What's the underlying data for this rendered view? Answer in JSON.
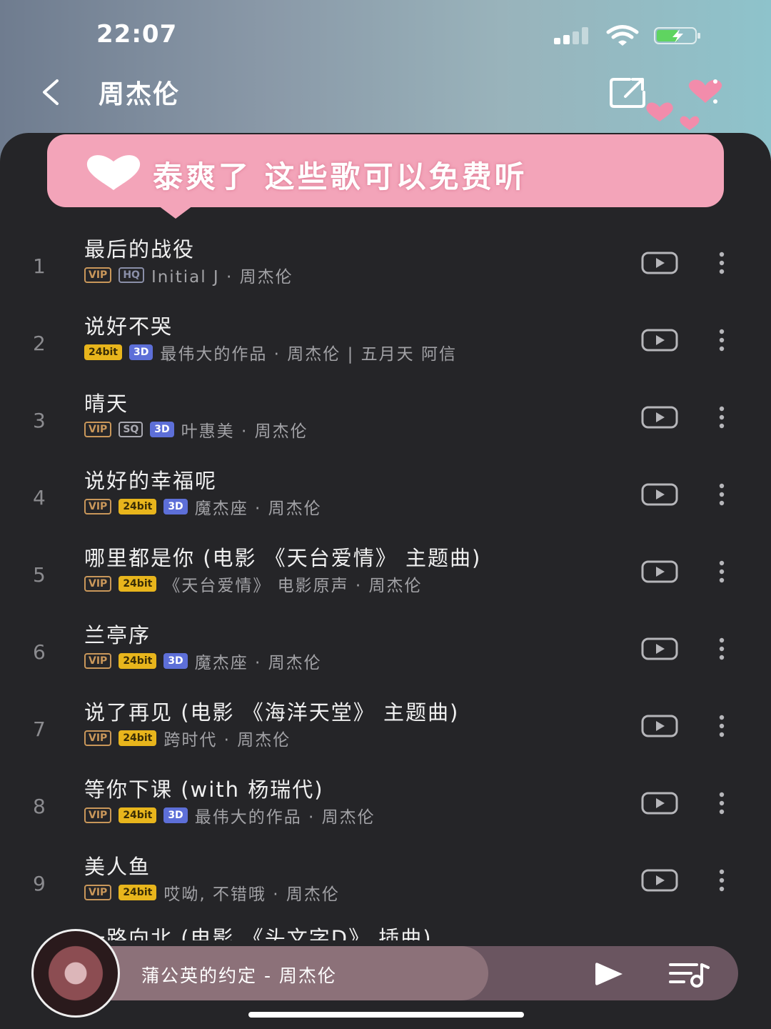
{
  "status": {
    "time": "22:07"
  },
  "header": {
    "title": "周杰伦"
  },
  "banner": {
    "text": "泰爽了 这些歌可以免费听"
  },
  "songs": [
    {
      "num": "1",
      "title": "最后的战役",
      "tags": [
        "VIP",
        "HQ"
      ],
      "sub": "Initial J · 周杰伦"
    },
    {
      "num": "2",
      "title": "说好不哭",
      "tags": [
        "24bit",
        "3D"
      ],
      "sub": "最伟大的作品 · 周杰伦 | 五月天 阿信"
    },
    {
      "num": "3",
      "title": "晴天",
      "tags": [
        "VIP",
        "SQ",
        "3D"
      ],
      "sub": "叶惠美 · 周杰伦"
    },
    {
      "num": "4",
      "title": "说好的幸福呢",
      "tags": [
        "VIP",
        "24bit",
        "3D"
      ],
      "sub": "魔杰座 · 周杰伦"
    },
    {
      "num": "5",
      "title": "哪里都是你 (电影 《天台爱情》 主题曲)",
      "tags": [
        "VIP",
        "24bit"
      ],
      "sub": "《天台爱情》 电影原声 · 周杰伦"
    },
    {
      "num": "6",
      "title": "兰亭序",
      "tags": [
        "VIP",
        "24bit",
        "3D"
      ],
      "sub": "魔杰座 · 周杰伦"
    },
    {
      "num": "7",
      "title": "说了再见 (电影 《海洋天堂》 主题曲)",
      "tags": [
        "VIP",
        "24bit"
      ],
      "sub": "跨时代 · 周杰伦"
    },
    {
      "num": "8",
      "title": "等你下课 (with 杨瑞代)",
      "tags": [
        "VIP",
        "24bit",
        "3D"
      ],
      "sub": "最伟大的作品 · 周杰伦"
    },
    {
      "num": "9",
      "title": "美人鱼",
      "tags": [
        "VIP",
        "24bit"
      ],
      "sub": "哎呦, 不错哦 · 周杰伦"
    }
  ],
  "partial_row": {
    "title": "一路向北 (电影 《头文字D》 插曲)"
  },
  "player": {
    "now_playing": "蒲公英的约定 - 周杰伦"
  },
  "icons": {
    "back": "back-chevron-icon",
    "share": "share-icon",
    "mv": "mv-play-icon",
    "more": "more-dots-icon",
    "play": "play-icon",
    "queue": "playlist-icon",
    "heart": "heart-icon"
  },
  "colors": {
    "background": "#232326",
    "banner": "#f3a4b9",
    "vip": "#c9975a",
    "bit24": "#e8b51c",
    "tag3d": "#5d6fd8",
    "player": "#6a5560"
  }
}
